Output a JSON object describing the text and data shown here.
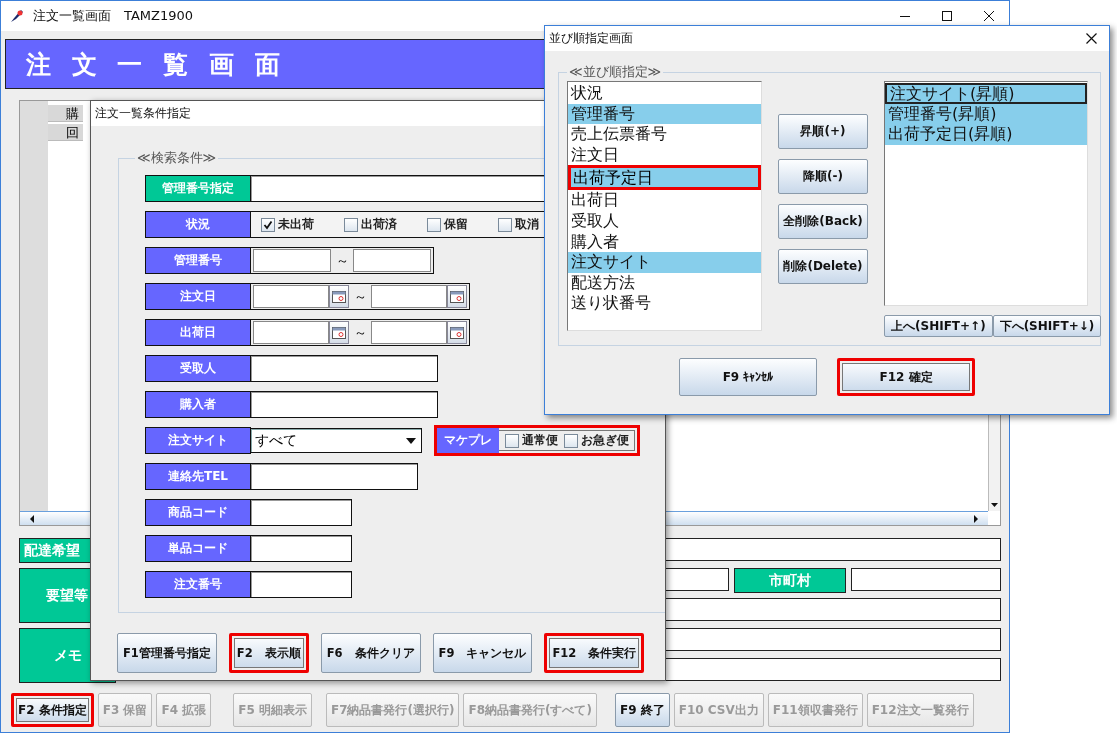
{
  "main_window": {
    "title": "注文一覧画面　TAMZ1900",
    "header": "注 文 一 覧 画 面",
    "table": {
      "header_cells": [
        "購",
        "回"
      ]
    },
    "details": {
      "labels": [
        "配達希望",
        "要望等",
        "メモ"
      ],
      "city_label": "市町村"
    },
    "function_keys": [
      {
        "label": "F2 条件指定",
        "disabled": false,
        "highlighted": true
      },
      {
        "label": "F3 保留",
        "disabled": true,
        "highlighted": false
      },
      {
        "label": "F4 拡張",
        "disabled": true,
        "highlighted": false
      },
      {
        "label": "F5 明細表示",
        "disabled": true,
        "highlighted": false
      },
      {
        "label": "F7納品書発行(選択行)",
        "disabled": true,
        "highlighted": false
      },
      {
        "label": "F8納品書発行(すべて)",
        "disabled": true,
        "highlighted": false
      },
      {
        "label": "F9 終了",
        "disabled": false,
        "highlighted": false
      },
      {
        "label": "F10 CSV出力",
        "disabled": true,
        "highlighted": false
      },
      {
        "label": "F11領収書発行",
        "disabled": true,
        "highlighted": false
      },
      {
        "label": "F12注文一覧発行",
        "disabled": true,
        "highlighted": false
      }
    ]
  },
  "search_dialog": {
    "title": "注文一覧条件指定",
    "group_title": "≪検索条件≫",
    "fields": [
      {
        "kind": "longtext",
        "label": "管理番号指定",
        "color": "#00c896"
      },
      {
        "kind": "checks",
        "label": "状況",
        "color": "#6666ff",
        "options": [
          {
            "label": "未出荷",
            "checked": true
          },
          {
            "label": "出荷済",
            "checked": false
          },
          {
            "label": "保留",
            "checked": false
          },
          {
            "label": "取消",
            "checked": false
          }
        ]
      },
      {
        "kind": "range",
        "label": "管理番号",
        "color": "#6666ff",
        "separator": "～"
      },
      {
        "kind": "daterange",
        "label": "注文日",
        "color": "#6666ff",
        "separator": "～"
      },
      {
        "kind": "daterange",
        "label": "出荷日",
        "color": "#6666ff",
        "separator": "～"
      },
      {
        "kind": "text",
        "label": "受取人",
        "color": "#6666ff"
      },
      {
        "kind": "text",
        "label": "購入者",
        "color": "#6666ff"
      },
      {
        "kind": "select",
        "label": "注文サイト",
        "color": "#6666ff",
        "value": "すべて",
        "extra": {
          "label": "マケプレ",
          "highlighted": true,
          "options": [
            {
              "label": "通常便",
              "checked": false
            },
            {
              "label": "お急ぎ便",
              "checked": false
            }
          ]
        }
      },
      {
        "kind": "phone",
        "label": "連絡先TEL",
        "color": "#6666ff"
      },
      {
        "kind": "shorttext",
        "label": "商品コード",
        "color": "#6666ff"
      },
      {
        "kind": "shorttext",
        "label": "単品コード",
        "color": "#6666ff"
      },
      {
        "kind": "shorttext",
        "label": "注文番号",
        "color": "#6666ff"
      }
    ],
    "buttons": [
      {
        "label": "F1管理番号指定",
        "highlighted": false
      },
      {
        "label": "F2　表示順",
        "highlighted": true
      },
      {
        "label": "F6　条件クリア",
        "highlighted": false
      },
      {
        "label": "F9　キャンセル",
        "highlighted": false
      },
      {
        "label": "F12　条件実行",
        "highlighted": true
      }
    ]
  },
  "sort_dialog": {
    "title": "並び順指定画面",
    "group_title": "≪並び順指定≫",
    "available": [
      {
        "label": "状況",
        "selected": false,
        "focused": false,
        "highlighted": false
      },
      {
        "label": "管理番号",
        "selected": true,
        "focused": false,
        "highlighted": false
      },
      {
        "label": "売上伝票番号",
        "selected": false,
        "focused": false,
        "highlighted": false
      },
      {
        "label": "注文日",
        "selected": false,
        "focused": false,
        "highlighted": false
      },
      {
        "label": "出荷予定日",
        "selected": true,
        "focused": true,
        "highlighted": true
      },
      {
        "label": "出荷日",
        "selected": false,
        "focused": false,
        "highlighted": false
      },
      {
        "label": "受取人",
        "selected": false,
        "focused": false,
        "highlighted": false
      },
      {
        "label": "購入者",
        "selected": false,
        "focused": false,
        "highlighted": false
      },
      {
        "label": "注文サイト",
        "selected": true,
        "focused": false,
        "highlighted": false
      },
      {
        "label": "配送方法",
        "selected": false,
        "focused": false,
        "highlighted": false
      },
      {
        "label": "送り状番号",
        "selected": false,
        "focused": false,
        "highlighted": false
      }
    ],
    "actions": [
      "昇順(+)",
      "降順(-)",
      "全削除(Back)",
      "削除(Delete)"
    ],
    "chosen": [
      {
        "label": "注文サイト(昇順)",
        "selected": true,
        "focused": true
      },
      {
        "label": "管理番号(昇順)",
        "selected": true,
        "focused": false
      },
      {
        "label": "出荷予定日(昇順)",
        "selected": true,
        "focused": false
      }
    ],
    "move_buttons": [
      "上へ(SHIFT+↑)",
      "下へ(SHIFT+↓)"
    ],
    "buttons": [
      {
        "label": "F9 ｷｬﾝｾﾙ",
        "highlighted": false
      },
      {
        "label": "F12 確定",
        "highlighted": true
      }
    ]
  }
}
